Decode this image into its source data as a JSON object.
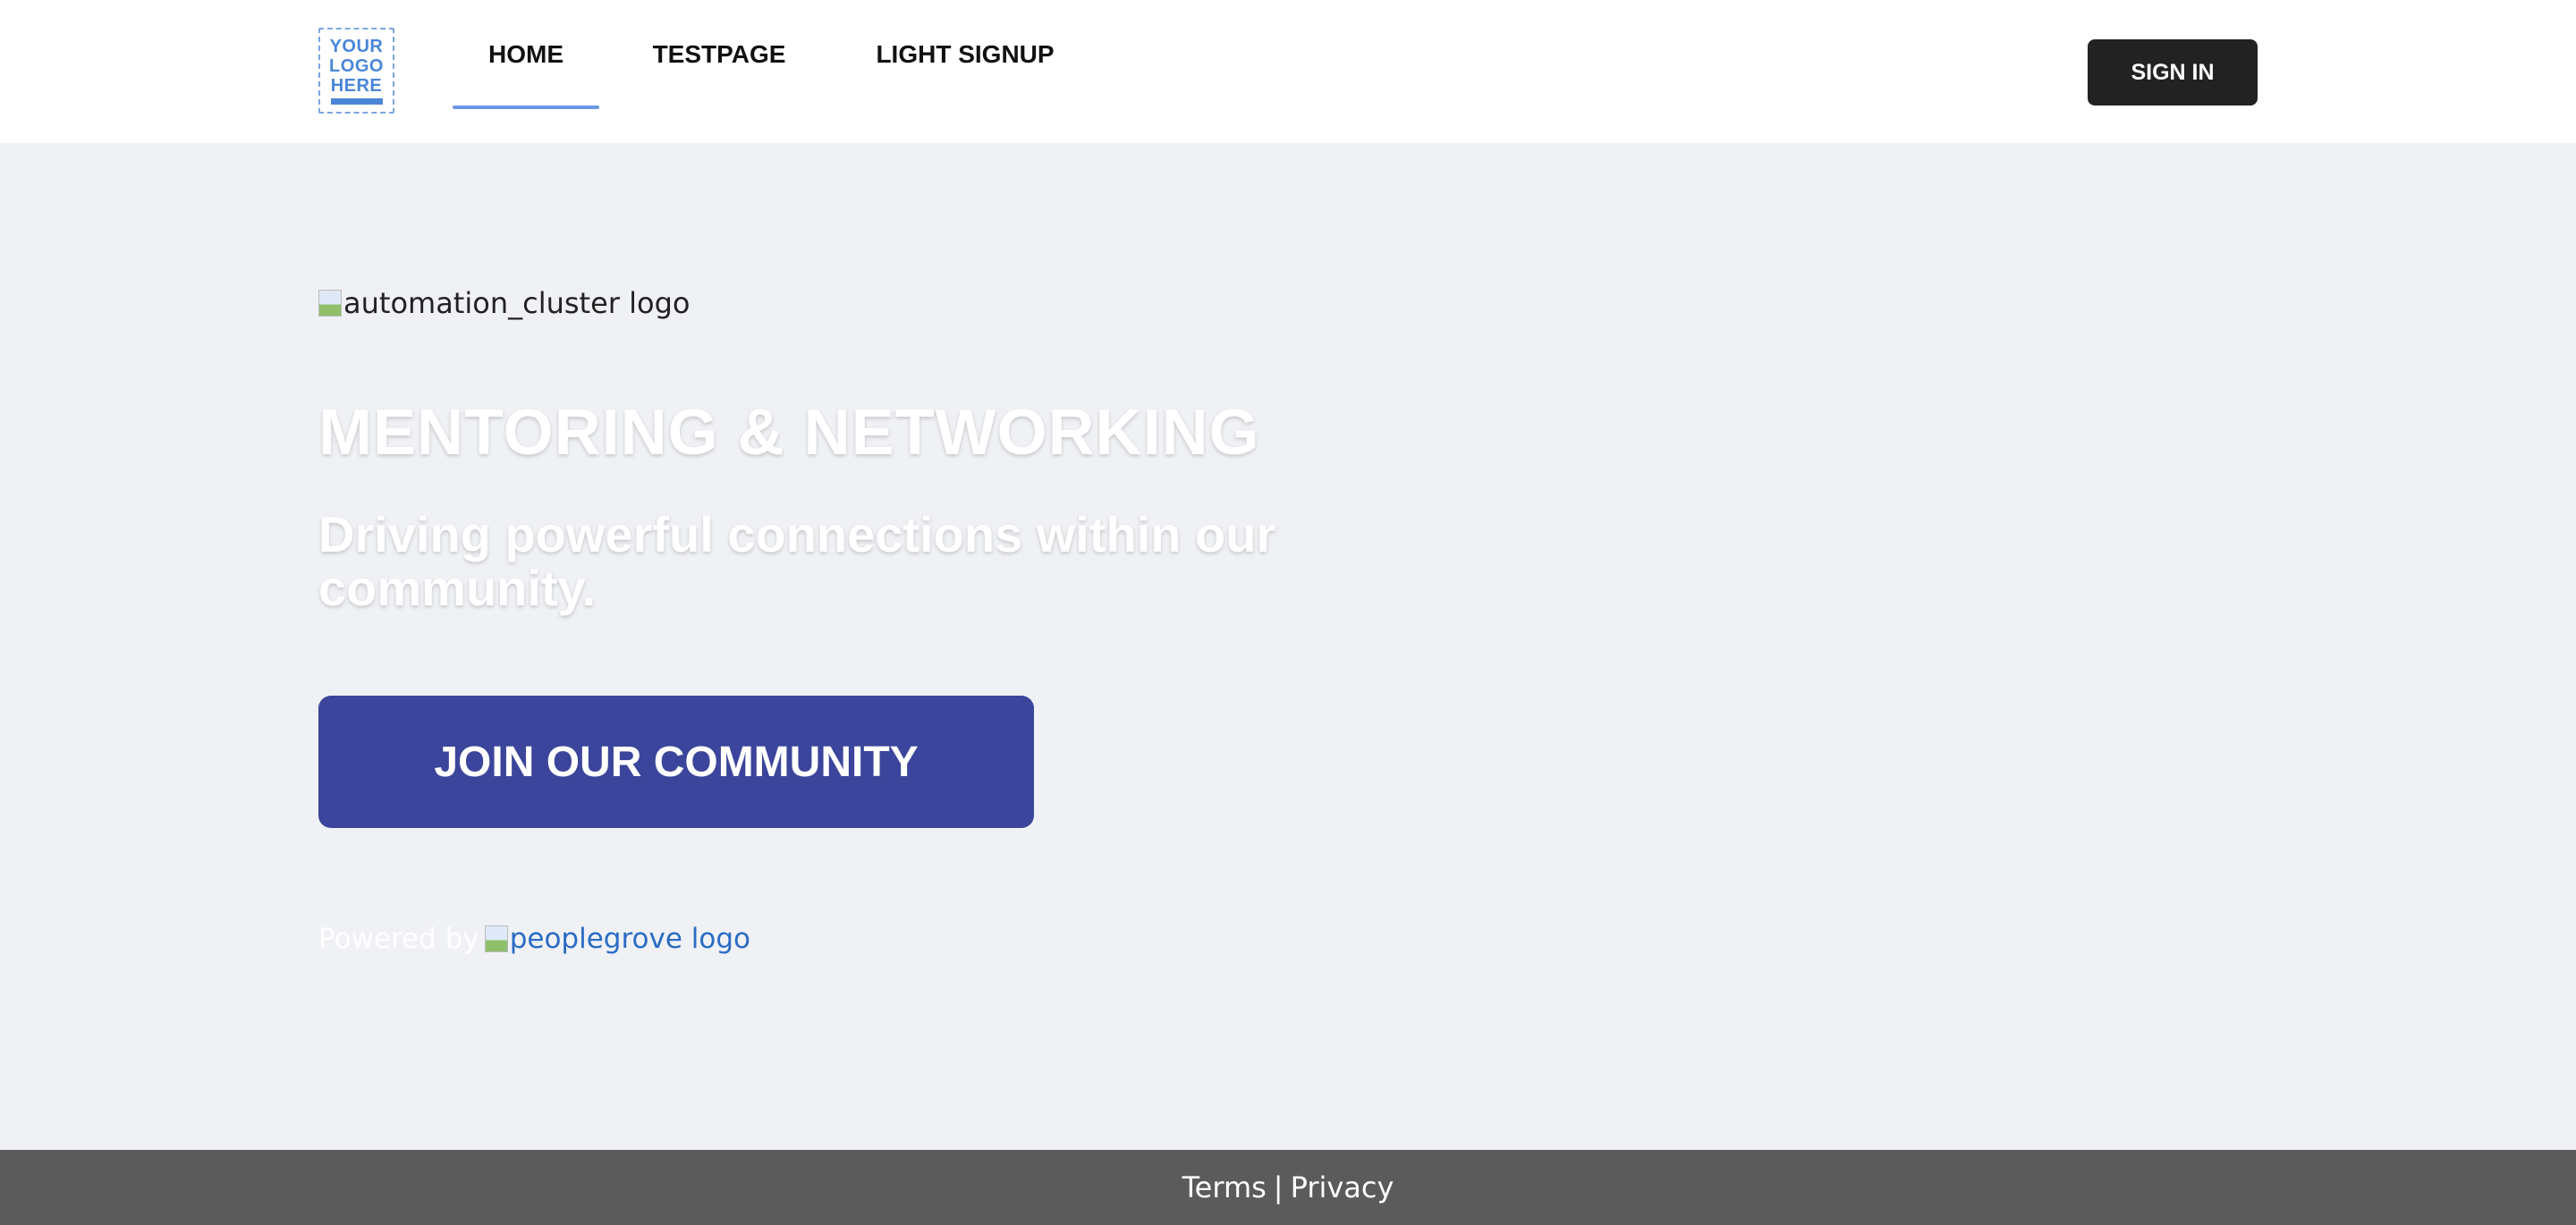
{
  "header": {
    "logo": {
      "lines": [
        "YOUR",
        "LOGO",
        "HERE"
      ]
    },
    "nav": [
      {
        "label": "HOME",
        "active": true
      },
      {
        "label": "TESTPAGE",
        "active": false
      },
      {
        "label": "LIGHT SIGNUP",
        "active": false
      }
    ],
    "signin_label": "SIGN IN"
  },
  "hero": {
    "brand_logo_alt": "automation_cluster logo",
    "title": "MENTORING & NETWORKING",
    "subtitle": "Driving powerful connections within our community.",
    "cta_label": "JOIN OUR COMMUNITY",
    "powered_by_label": "Powered by",
    "powered_logo_alt": "peoplegrove logo"
  },
  "footer": {
    "terms_label": "Terms",
    "separator": "|",
    "privacy_label": "Privacy"
  },
  "colors": {
    "page_bg": "#eff1f5",
    "header_bg": "#ffffff",
    "accent_underline": "#6b96e4",
    "cta_bg": "#3b459b",
    "signin_bg": "#222222",
    "footer_bg": "#5b5b5b",
    "link_blue": "#2b6cc4"
  }
}
